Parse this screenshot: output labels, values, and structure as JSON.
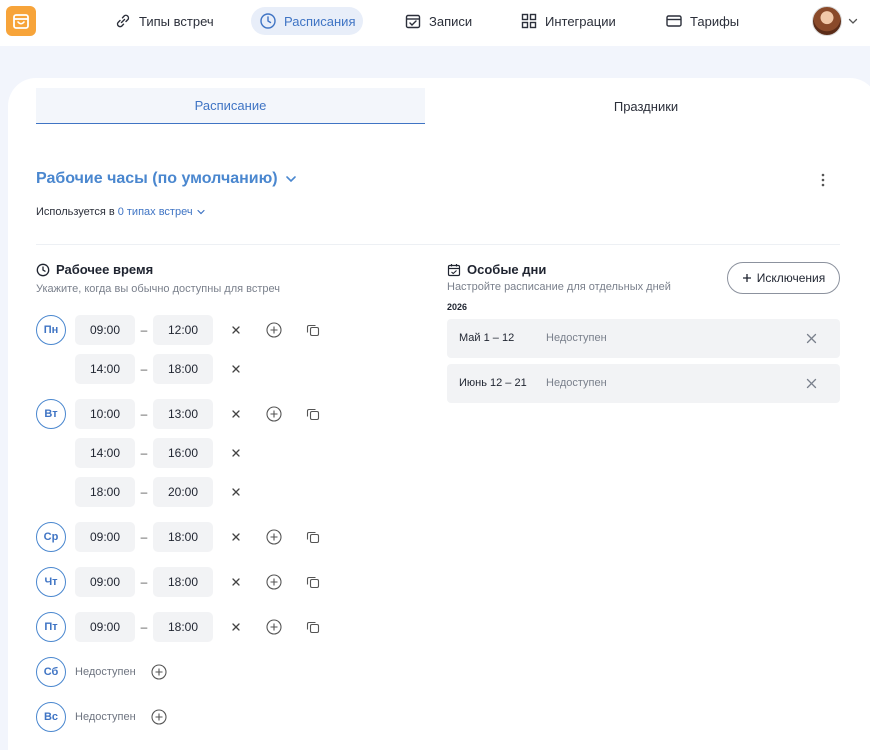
{
  "nav": {
    "items": [
      {
        "label": "Типы встреч",
        "icon": "link-icon"
      },
      {
        "label": "Расписания",
        "icon": "clock-icon",
        "active": true
      },
      {
        "label": "Записи",
        "icon": "calendar-check-icon"
      },
      {
        "label": "Интеграции",
        "icon": "grid-icon"
      },
      {
        "label": "Тарифы",
        "icon": "credit-card-icon"
      }
    ]
  },
  "tabs": [
    {
      "label": "Расписание",
      "active": true
    },
    {
      "label": "Праздники",
      "active": false
    }
  ],
  "schedule": {
    "title": "Рабочие часы (по умолчанию)",
    "used_in_prefix": "Используется в",
    "used_in_link": "0 типах встреч"
  },
  "working_hours": {
    "title": "Рабочее время",
    "subtitle": "Укажите, когда вы обычно доступны для встреч",
    "unavailable_label": "Недоступен",
    "days": [
      {
        "label": "Пн",
        "slots": [
          [
            "09:00",
            "12:00"
          ],
          [
            "14:00",
            "18:00"
          ]
        ]
      },
      {
        "label": "Вт",
        "slots": [
          [
            "10:00",
            "13:00"
          ],
          [
            "14:00",
            "16:00"
          ],
          [
            "18:00",
            "20:00"
          ]
        ]
      },
      {
        "label": "Ср",
        "slots": [
          [
            "09:00",
            "18:00"
          ]
        ]
      },
      {
        "label": "Чт",
        "slots": [
          [
            "09:00",
            "18:00"
          ]
        ]
      },
      {
        "label": "Пт",
        "slots": [
          [
            "09:00",
            "18:00"
          ]
        ]
      },
      {
        "label": "Сб",
        "slots": []
      },
      {
        "label": "Вс",
        "slots": []
      }
    ],
    "dash": "–"
  },
  "special_days": {
    "title": "Особые дни",
    "subtitle": "Настройте расписание для отдельных дней",
    "add_button_label": "Исключения",
    "year": "2026",
    "items": [
      {
        "date": "Май 1 – 12",
        "status": "Недоступен"
      },
      {
        "date": "Июнь 12 – 21",
        "status": "Недоступен"
      }
    ]
  },
  "colors": {
    "accent": "#3f74c4",
    "logo": "#f7a43a",
    "page_bg": "#f2f5fc"
  }
}
